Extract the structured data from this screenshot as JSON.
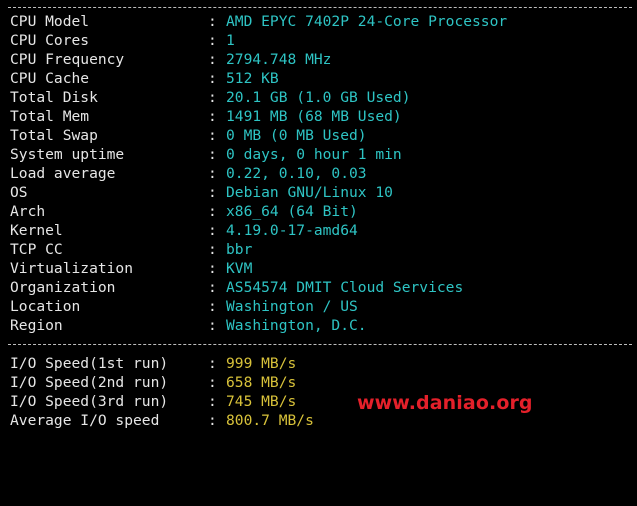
{
  "terminal": {
    "colors": {
      "background": "#000000",
      "label": "#e6e6e6",
      "value_info": "#2ec4c4",
      "value_io": "#d8c23a",
      "watermark": "#e4202a"
    },
    "separator": ":",
    "system_info": [
      {
        "label": "CPU Model",
        "value": "AMD EPYC 7402P 24-Core Processor"
      },
      {
        "label": "CPU Cores",
        "value": "1"
      },
      {
        "label": "CPU Frequency",
        "value": "2794.748 MHz"
      },
      {
        "label": "CPU Cache",
        "value": "512 KB"
      },
      {
        "label": "Total Disk",
        "value": "20.1 GB (1.0 GB Used)"
      },
      {
        "label": "Total Mem",
        "value": "1491 MB (68 MB Used)"
      },
      {
        "label": "Total Swap",
        "value": "0 MB (0 MB Used)"
      },
      {
        "label": "System uptime",
        "value": "0 days, 0 hour 1 min"
      },
      {
        "label": "Load average",
        "value": "0.22, 0.10, 0.03"
      },
      {
        "label": "OS",
        "value": "Debian GNU/Linux 10"
      },
      {
        "label": "Arch",
        "value": "x86_64 (64 Bit)"
      },
      {
        "label": "Kernel",
        "value": "4.19.0-17-amd64"
      },
      {
        "label": "TCP CC",
        "value": "bbr"
      },
      {
        "label": "Virtualization",
        "value": "KVM"
      },
      {
        "label": "Organization",
        "value": "AS54574 DMIT Cloud Services"
      },
      {
        "label": "Location",
        "value": "Washington / US"
      },
      {
        "label": "Region",
        "value": "Washington, D.C."
      }
    ],
    "io_speed": [
      {
        "label": "I/O Speed(1st run)",
        "value": "999 MB/s"
      },
      {
        "label": "I/O Speed(2nd run)",
        "value": "658 MB/s"
      },
      {
        "label": "I/O Speed(3rd run)",
        "value": "745 MB/s"
      },
      {
        "label": "Average I/O speed",
        "value": "800.7 MB/s"
      }
    ],
    "watermark": "www.daniao.org"
  }
}
